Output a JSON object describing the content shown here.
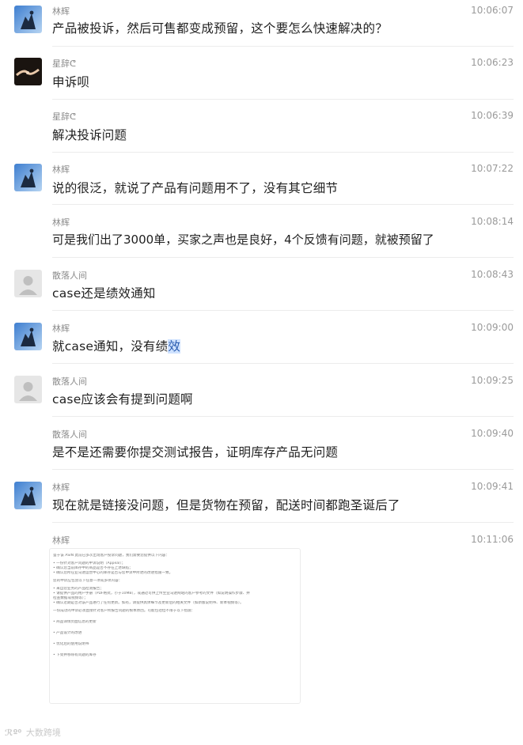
{
  "messages": [
    {
      "name": "林辉",
      "time": "10:06:07",
      "text": "产品被投诉，然后可售都变成预留，这个要怎么快速解决的？"
    },
    {
      "name": "星辞ᕦ",
      "time": "10:06:23",
      "text": "申诉呗"
    },
    {
      "name": "星辞ᕦ",
      "time": "10:06:39",
      "text": "解决投诉问题"
    },
    {
      "name": "林辉",
      "time": "10:07:22",
      "text": "说的很泛，就说了产品有问题用不了，没有其它细节"
    },
    {
      "name": "林辉",
      "time": "10:08:14",
      "text": "可是我们出了3000单，买家之声也是良好，4个反馈有问题，就被预留了"
    },
    {
      "name": "散落人间",
      "time": "10:08:43",
      "text": "case还是绩效通知"
    },
    {
      "name": "林辉",
      "time": "10:09:00",
      "text_main": "就case通知，没有绩",
      "text_hl": "效"
    },
    {
      "name": "散落人间",
      "time": "10:09:25",
      "text": "case应该会有提到问题啊"
    },
    {
      "name": "散落人间",
      "time": "10:09:40",
      "text": "是不是还需要你提交测试报告，证明库存产品无问题"
    },
    {
      "name": "林辉",
      "time": "10:09:41",
      "text": "现在就是链接没问题，但是货物在预留，配送时间都跑圣诞后了"
    },
    {
      "name": "林辉",
      "time": "10:11:06"
    }
  ],
  "attachment": {
    "lines": [
      "鉴于该 ASIN 此前已多次出现客户投诉问题，我们需要您提供以下内容：",
      "",
      "• 一份针对客户问题的申诉说明（Appeal）；",
      "• 确认您当前库存中的商品是否不存在上述缺陷；",
      "• 确认您所在亚马逊运营中心的库存是否与您申诉中所述的改进措施一致。",
      "",
      "您的申诉应包含以下任意一项或多项内容：",
      "",
      "• 来自您业务的产品检测报告；",
      "• 请提供产品的用户手册（PDF格式，小于10MB），或通过可供上传至亚马逊网站的客户参考的文件（如说明操作步骤、并",
      "   检查数据或视频等）；",
      "• 确认近期是否对该产品进行了任何更新。如有，请提供具体细节及更新后的相关文件（如新版说明书、新本视频等）。",
      "",
      "一份成功的申诉必须直接针对客户所报告问题的根本原因。可能包括但不限于以下措施：",
      "",
      "",
      "• 商品详情页面信息的更新",
      "",
      "",
      "• 产品设计的改进",
      "",
      "",
      "• 优化后的使用说明书",
      "",
      "",
      "• 下架并移除有问题的库存"
    ]
  },
  "watermark": {
    "logo": "ℛº⁰",
    "text": "大数跨境"
  }
}
